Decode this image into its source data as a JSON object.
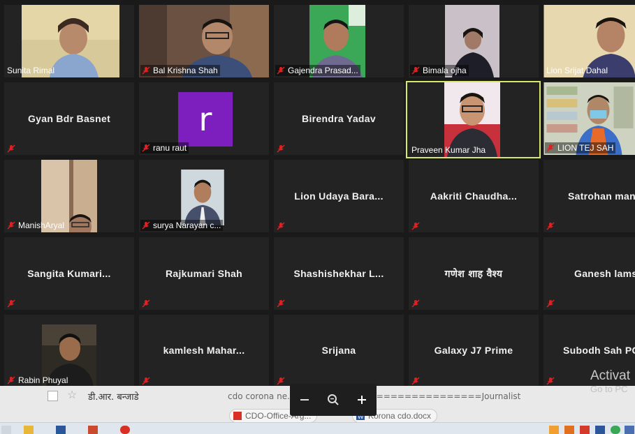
{
  "participants": [
    {
      "name": "Sunita Rimal",
      "muted": false
    },
    {
      "name": "Bal Krishna Shah",
      "muted": true
    },
    {
      "name": "Gajendra Prasad...",
      "muted": true
    },
    {
      "name": "Bimala ojha",
      "muted": true
    },
    {
      "name": "Lion Srijat Dahal",
      "muted": false
    },
    {
      "name": "Gyan Bdr Basnet",
      "muted": true
    },
    {
      "name": "ranu raut",
      "muted": true,
      "avatar_letter": "r"
    },
    {
      "name": "Birendra Yadav",
      "muted": true
    },
    {
      "name": "Praveen Kumar Jha",
      "muted": false,
      "active_speaker": true
    },
    {
      "name": "LION TEJ SAH",
      "muted": true
    },
    {
      "name": "ManishAryal",
      "muted": true
    },
    {
      "name": "surya Narayan c...",
      "muted": true
    },
    {
      "name": "Lion Udaya Bara...",
      "muted": true
    },
    {
      "name": "Aakriti  Chaudha...",
      "muted": true
    },
    {
      "name": "Satrohan man",
      "muted": true
    },
    {
      "name": "Sangita  Kumari...",
      "muted": true
    },
    {
      "name": "Rajkumari Shah",
      "muted": true
    },
    {
      "name": "Shashishekhar  L...",
      "muted": true
    },
    {
      "name": "गणेश शाह वैश्य",
      "muted": true
    },
    {
      "name": "Ganesh lamsa",
      "muted": true
    },
    {
      "name": "Rabin Phuyal",
      "muted": true
    },
    {
      "name": "kamlesh  Mahar...",
      "muted": true
    },
    {
      "name": "Srijana",
      "muted": true
    },
    {
      "name": "Galaxy J7 Prime",
      "muted": true
    },
    {
      "name": "Subodh  Sah  PC",
      "muted": true
    }
  ],
  "email": {
    "sender": "डी.आर. बन्जाडे",
    "snippet": "cdo corona ne... आर. बन्जाडे) ====================Journalist",
    "attachments": [
      "CDO-Office-Arg...",
      "Korona cdo.docx"
    ]
  },
  "watermark": {
    "title": "Activat",
    "subtitle": "Go to PC"
  },
  "colors": {
    "active_border": "#d8e86b",
    "avatar_bg": "#7d1fbf",
    "mute_icon": "#e02020"
  }
}
